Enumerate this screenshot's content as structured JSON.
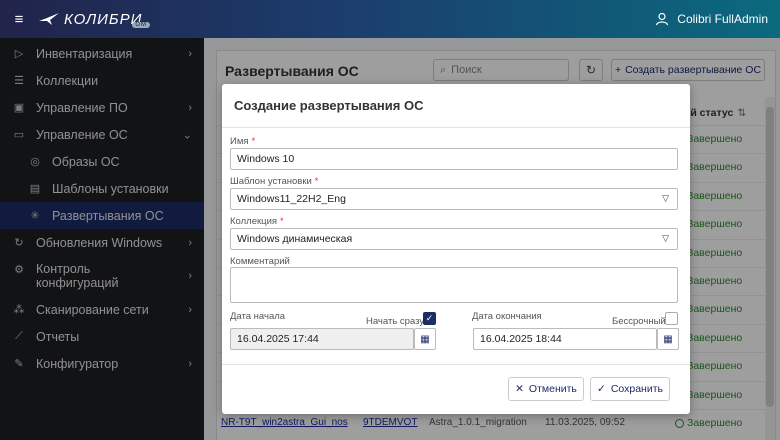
{
  "topbar": {
    "brand": "КОЛИБРИ",
    "brand_badge": "ОМ",
    "user_name": "Colibri FullAdmin"
  },
  "sidebar": {
    "items": [
      {
        "label": "Инвентаризация",
        "icon": "inventory-icon",
        "chevron": "›"
      },
      {
        "label": "Коллекции",
        "icon": "list-icon"
      },
      {
        "label": "Управление ПО",
        "icon": "software-icon",
        "chevron": "›"
      },
      {
        "label": "Управление ОС",
        "icon": "monitor-icon",
        "chevron": "⌄"
      },
      {
        "label": "Образы ОС",
        "icon": "disc-icon"
      },
      {
        "label": "Шаблоны установки",
        "icon": "template-icon"
      },
      {
        "label": "Развертывания ОС",
        "icon": "snowflake-icon"
      },
      {
        "label": "Обновления Windows",
        "icon": "sync-icon",
        "chevron": "›"
      },
      {
        "label": "Контроль конфигураций",
        "icon": "gear-icon",
        "chevron": "›"
      },
      {
        "label": "Сканирование сети",
        "icon": "network-icon",
        "chevron": "›"
      },
      {
        "label": "Отчеты",
        "icon": "chart-icon"
      },
      {
        "label": "Конфигуратор",
        "icon": "wrench-icon",
        "chevron": "›"
      }
    ]
  },
  "page": {
    "title": "Развертывания ОС",
    "search_placeholder": "Поиск",
    "create_label": "Создать развертывание ОС",
    "status_column": "щий статус",
    "status_values": [
      "Завершено",
      "Завершено",
      "Завершено",
      "Завершено",
      "Завершено",
      "Завершено",
      "Завершено",
      "Завершено",
      "Завершено",
      "Завершено",
      "Завершено"
    ],
    "last_row": {
      "name": "NR-T9T_win2astra_Gui_nos",
      "id": "9TDEMVOT",
      "template": "Astra_1.0.1_migration",
      "date": "11.03.2025, 09:52"
    }
  },
  "modal": {
    "title": "Создание развертывания ОС",
    "name_label": "Имя",
    "name_value": "Windows 10",
    "template_label": "Шаблон установки",
    "template_value": "Windows11_22H2_Eng",
    "collection_label": "Коллекция",
    "collection_value": "Windows динамическая",
    "comment_label": "Комментарий",
    "comment_value": "",
    "start_label": "Дата начала",
    "start_now_label": "Начать сразу",
    "start_now_checked": true,
    "start_value": "16.04.2025 17:44",
    "end_label": "Дата окончания",
    "indefinite_label": "Бессрочный",
    "indefinite_checked": false,
    "end_value": "16.04.2025 18:44",
    "cancel_label": "Отменить",
    "save_label": "Сохранить",
    "required_mark": "*"
  }
}
